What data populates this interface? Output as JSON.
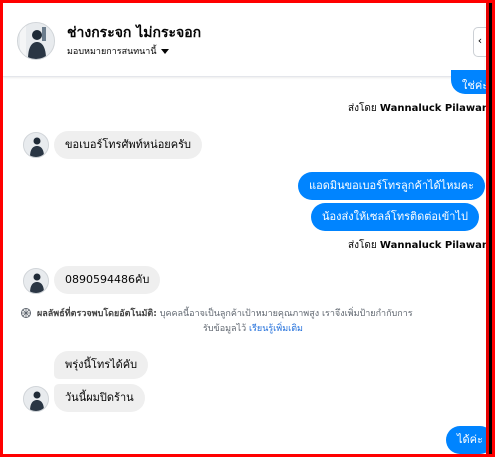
{
  "header": {
    "contact_name": "ช่างกระจก ไม่กระจอก",
    "assign_label": "มอบหมายการสนทนานี้",
    "corner_glyph": "‹"
  },
  "messages": {
    "m1": "ใช่ค่ะ",
    "sent_by_1_prefix": "ส่งโดย",
    "sent_by_1_name": "Wannaluck Pilawan",
    "m2": "ขอเบอร์โทรศัพท์หน่อยครับ",
    "m3": "แอดมินขอเบอร์โทรลูกค้าได้ไหมคะ",
    "m4": "น้องส่งให้เซลล์โทรติดต่อเข้าไป",
    "sent_by_2_prefix": "ส่งโดย",
    "sent_by_2_name": "Wannaluck Pilawan",
    "m5": "0890594486คับ",
    "m6": "พรุ่งนี้โทรได้คับ",
    "m7": "วันนี้ผมปิดร้าน",
    "m8": "ได้ค่ะ"
  },
  "notice": {
    "title": "ผลลัพธ์ที่ตรวจพบโดยอัตโนมัติ:",
    "text": "บุคคลนี้อาจเป็นลูกค้าเป้าหมายคุณภาพสูง เราจึงเพิ่มป้ายกำกับการ",
    "text2": "รับข้อมูลไว้",
    "link": "เรียนรู้เพิ่มเติม"
  },
  "colors": {
    "outgoing": "#0084ff",
    "incoming": "#efefef",
    "frame": "#ff0000",
    "link": "#216fdb"
  },
  "icons": {
    "caret": "chevron-down-icon",
    "info": "info-icon",
    "notice": "sparkle-icon"
  }
}
